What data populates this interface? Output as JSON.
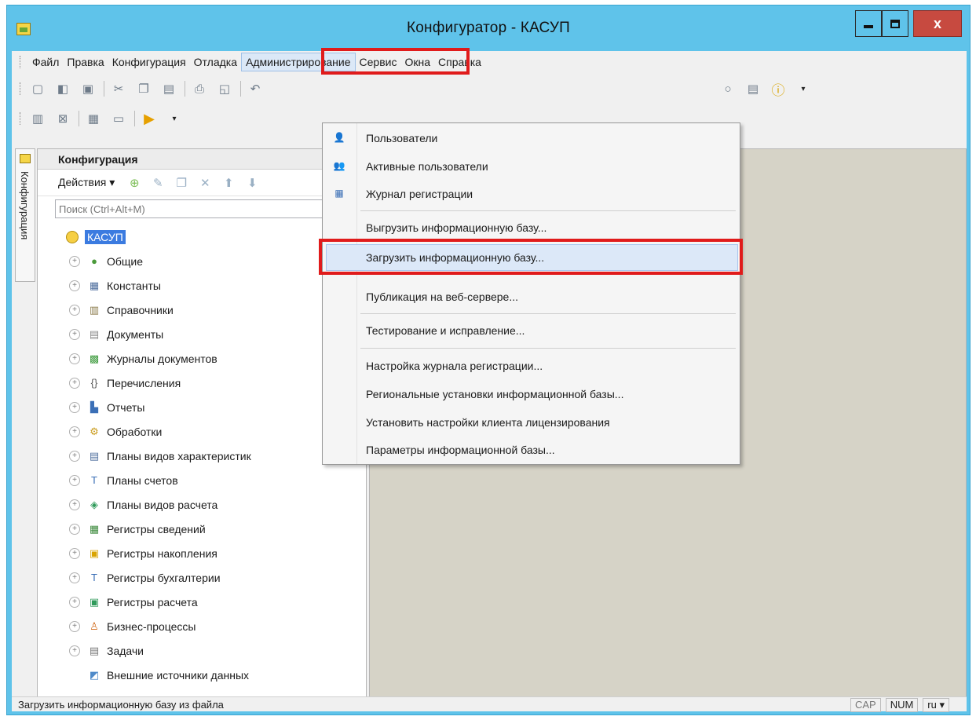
{
  "window": {
    "title": "Конфигуратор - КАСУП",
    "close_label": "x"
  },
  "menubar": {
    "items": [
      "Файл",
      "Правка",
      "Конфигурация",
      "Отладка",
      "Администрирование",
      "Сервис",
      "Окна",
      "Справка"
    ],
    "active_index": 4
  },
  "admin_menu": {
    "items": [
      {
        "label": "Пользователи",
        "icon": "user-icon"
      },
      {
        "label": "Активные пользователи",
        "icon": "active-users-icon"
      },
      {
        "label": "Журнал регистрации",
        "icon": "event-log-icon"
      },
      {
        "label": "Выгрузить информационную базу..."
      },
      {
        "label": "Загрузить информационную базу...",
        "highlighted": true
      },
      {
        "label": "Публикация на веб-сервере..."
      },
      {
        "label": "Тестирование и исправление..."
      },
      {
        "label": "Настройка журнала регистрации..."
      },
      {
        "label": "Региональные установки информационной базы..."
      },
      {
        "label": "Установить настройки клиента лицензирования"
      },
      {
        "label": "Параметры информационной базы..."
      }
    ]
  },
  "left_tab": {
    "label": "Конфигурация"
  },
  "config_panel": {
    "title": "Конфигурация",
    "actions_label": "Действия ▾",
    "search_placeholder": "Поиск (Ctrl+Alt+M)",
    "root": "КАСУП",
    "tree": [
      {
        "label": "Общие",
        "icon": "common-icon"
      },
      {
        "label": "Константы",
        "icon": "constants-icon"
      },
      {
        "label": "Справочники",
        "icon": "catalogs-icon"
      },
      {
        "label": "Документы",
        "icon": "documents-icon"
      },
      {
        "label": "Журналы документов",
        "icon": "document-journals-icon"
      },
      {
        "label": "Перечисления",
        "icon": "enumerations-icon"
      },
      {
        "label": "Отчеты",
        "icon": "reports-icon"
      },
      {
        "label": "Обработки",
        "icon": "data-processors-icon"
      },
      {
        "label": "Планы видов характеристик",
        "icon": "characteristic-types-icon"
      },
      {
        "label": "Планы счетов",
        "icon": "chart-of-accounts-icon"
      },
      {
        "label": "Планы видов расчета",
        "icon": "calculation-types-icon"
      },
      {
        "label": "Регистры сведений",
        "icon": "information-registers-icon"
      },
      {
        "label": "Регистры накопления",
        "icon": "accumulation-registers-icon"
      },
      {
        "label": "Регистры бухгалтерии",
        "icon": "accounting-registers-icon"
      },
      {
        "label": "Регистры расчета",
        "icon": "calculation-registers-icon"
      },
      {
        "label": "Бизнес-процессы",
        "icon": "business-processes-icon"
      },
      {
        "label": "Задачи",
        "icon": "tasks-icon"
      },
      {
        "label": "Внешние источники данных",
        "icon": "external-data-sources-icon",
        "no_expander": true
      }
    ]
  },
  "statusbar": {
    "text": "Загрузить информационную базу из файла",
    "cap": "CAP",
    "num": "NUM",
    "lang": "ru ▾"
  },
  "colors": {
    "titlebar": "#5fc3ea",
    "highlight_frame": "#e01b1b",
    "selection": "#3b7be0"
  }
}
